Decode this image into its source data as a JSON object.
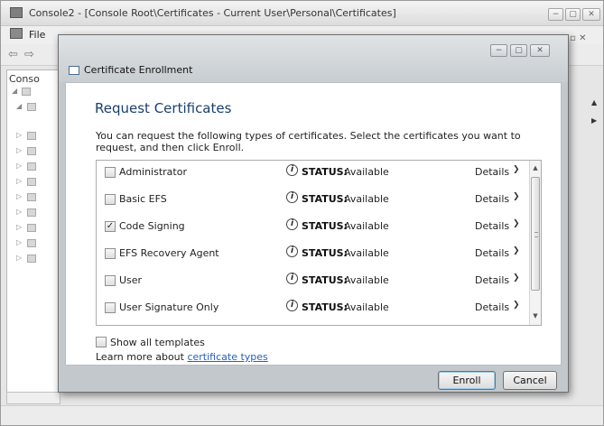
{
  "console": {
    "title": "Console2 - [Console Root\\Certificates - Current User\\Personal\\Certificates]",
    "menu_file": "File",
    "tree_header": "Conso",
    "caption_min": "−",
    "caption_max": "▢",
    "caption_close": "✕",
    "mdi_buttons": "_ ▫ ✕",
    "back_icon": "⇦",
    "forward_icon": "⇨"
  },
  "dialog": {
    "title": "Certificate Enrollment",
    "heading": "Request Certificates",
    "intro": "You can request the following types of certificates. Select the certificates you want to request, and then click Enroll.",
    "certificates": [
      {
        "name": "Administrator",
        "checked": false,
        "status_label": "STATUS:",
        "status_value": "Available",
        "details": "Details"
      },
      {
        "name": "Basic EFS",
        "checked": false,
        "status_label": "STATUS:",
        "status_value": "Available",
        "details": "Details"
      },
      {
        "name": "Code Signing",
        "checked": true,
        "status_label": "STATUS:",
        "status_value": "Available",
        "details": "Details"
      },
      {
        "name": "EFS Recovery Agent",
        "checked": false,
        "status_label": "STATUS:",
        "status_value": "Available",
        "details": "Details"
      },
      {
        "name": "User",
        "checked": false,
        "status_label": "STATUS:",
        "status_value": "Available",
        "details": "Details"
      },
      {
        "name": "User Signature Only",
        "checked": false,
        "status_label": "STATUS:",
        "status_value": "Available",
        "details": "Details"
      }
    ],
    "show_all_templates": "Show all templates",
    "learn_more_prefix": "Learn more about ",
    "learn_more_link": "certificate types",
    "enroll_button": "Enroll",
    "cancel_button": "Cancel"
  },
  "icons": {
    "info": "i",
    "chevron_down": "❯",
    "check": "✓",
    "scroll_up": "▲",
    "scroll_down": "▼"
  }
}
